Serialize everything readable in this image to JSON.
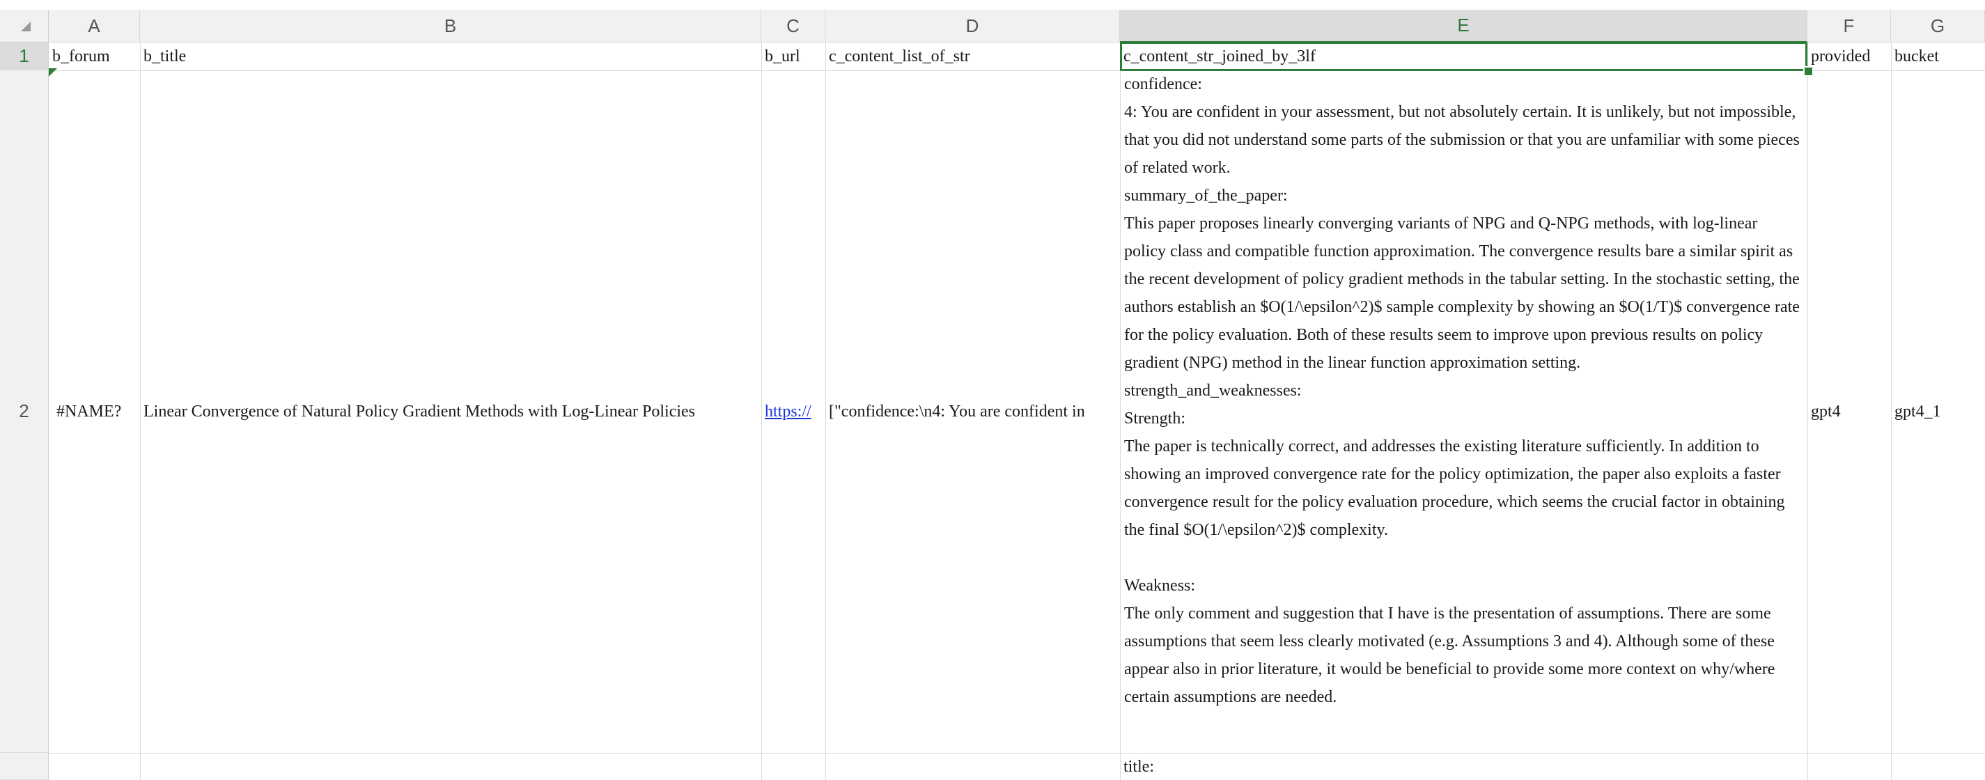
{
  "columns": [
    "A",
    "B",
    "C",
    "D",
    "E",
    "F",
    "G"
  ],
  "rows": [
    "1",
    "2"
  ],
  "header_row": {
    "a": "b_forum",
    "b": "b_title",
    "c": "b_url",
    "d": "c_content_list_of_str",
    "e": "c_content_str_joined_by_3lf",
    "f": "provided",
    "g": "bucket"
  },
  "row2": {
    "a": "#NAME?",
    "b": "Linear Convergence of Natural Policy Gradient Methods with Log-Linear Policies",
    "c": "https://",
    "d": "[\"confidence:\\n4: You are confident in",
    "e": "confidence:\n4: You are confident in your assessment, but not absolutely certain. It is unlikely, but not impossible, that you did not understand some parts of the submission or that you are unfamiliar with some pieces of related work.\nsummary_of_the_paper:\nThis paper proposes linearly converging variants of NPG and Q-NPG methods, with log-linear policy class and compatible function approximation. The convergence results bare a similar spirit as the recent development of policy gradient methods in the tabular setting. In the stochastic setting, the authors establish an $O(1/\\epsilon^2)$ sample complexity by showing an $O(1/T)$ convergence rate for the policy evaluation. Both of these results seem to improve upon previous results on policy gradient (NPG) method in the linear function approximation setting.\nstrength_and_weaknesses:\nStrength:\nThe paper is technically correct, and addresses the existing literature sufficiently. In addition to showing an improved convergence rate for the policy optimization, the paper also exploits a faster convergence result for the policy evaluation procedure, which seems the crucial factor in obtaining the final $O(1/\\epsilon^2)$ complexity.\n\nWeakness:\nThe only comment and suggestion that I have is the presentation of assumptions. There are some assumptions that seem less clearly motivated (e.g. Assumptions 3 and 4). Although some of these appear also in prior literature, it would be beneficial to provide some more context on why/where certain assumptions are needed.",
    "f": "gpt4",
    "g": "gpt4_1"
  },
  "row3_partial": {
    "e": "title:"
  },
  "colors": {
    "accent": "#2f7d3b",
    "link": "#1a35d8",
    "header_bg": "#f1f1f1"
  }
}
